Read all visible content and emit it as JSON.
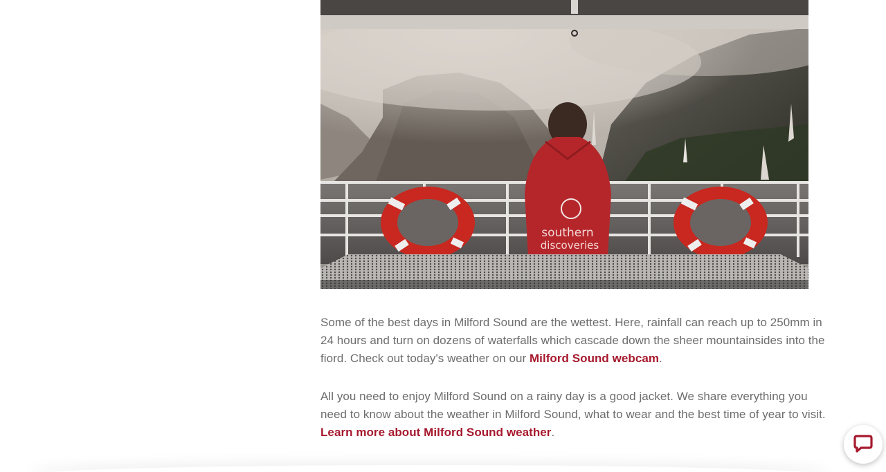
{
  "photo": {
    "jacket_text_line1": "southern",
    "jacket_text_line2": "discoveries"
  },
  "article": {
    "paragraph1_text": "Some of the best days in Milford Sound are the wettest. Here, rainfall can reach up to 250mm in 24 hours and turn on dozens of waterfalls which cascade down the sheer mountainsides into the fiord. Check out today's weather on our ",
    "paragraph1_link": "Milford Sound webcam",
    "paragraph1_end": ".",
    "paragraph2_text": "All you need to enjoy Milford Sound on a rainy day is a good jacket. We share everything you need to know about the weather in Milford Sound, what to wear and the best time of year to visit.",
    "paragraph2_link": "Learn more about Milford Sound weather",
    "paragraph2_end": "."
  },
  "colors": {
    "link": "#a6192e",
    "body_text": "#6d6d6d"
  },
  "chat": {
    "icon": "chat-bubble-icon"
  }
}
